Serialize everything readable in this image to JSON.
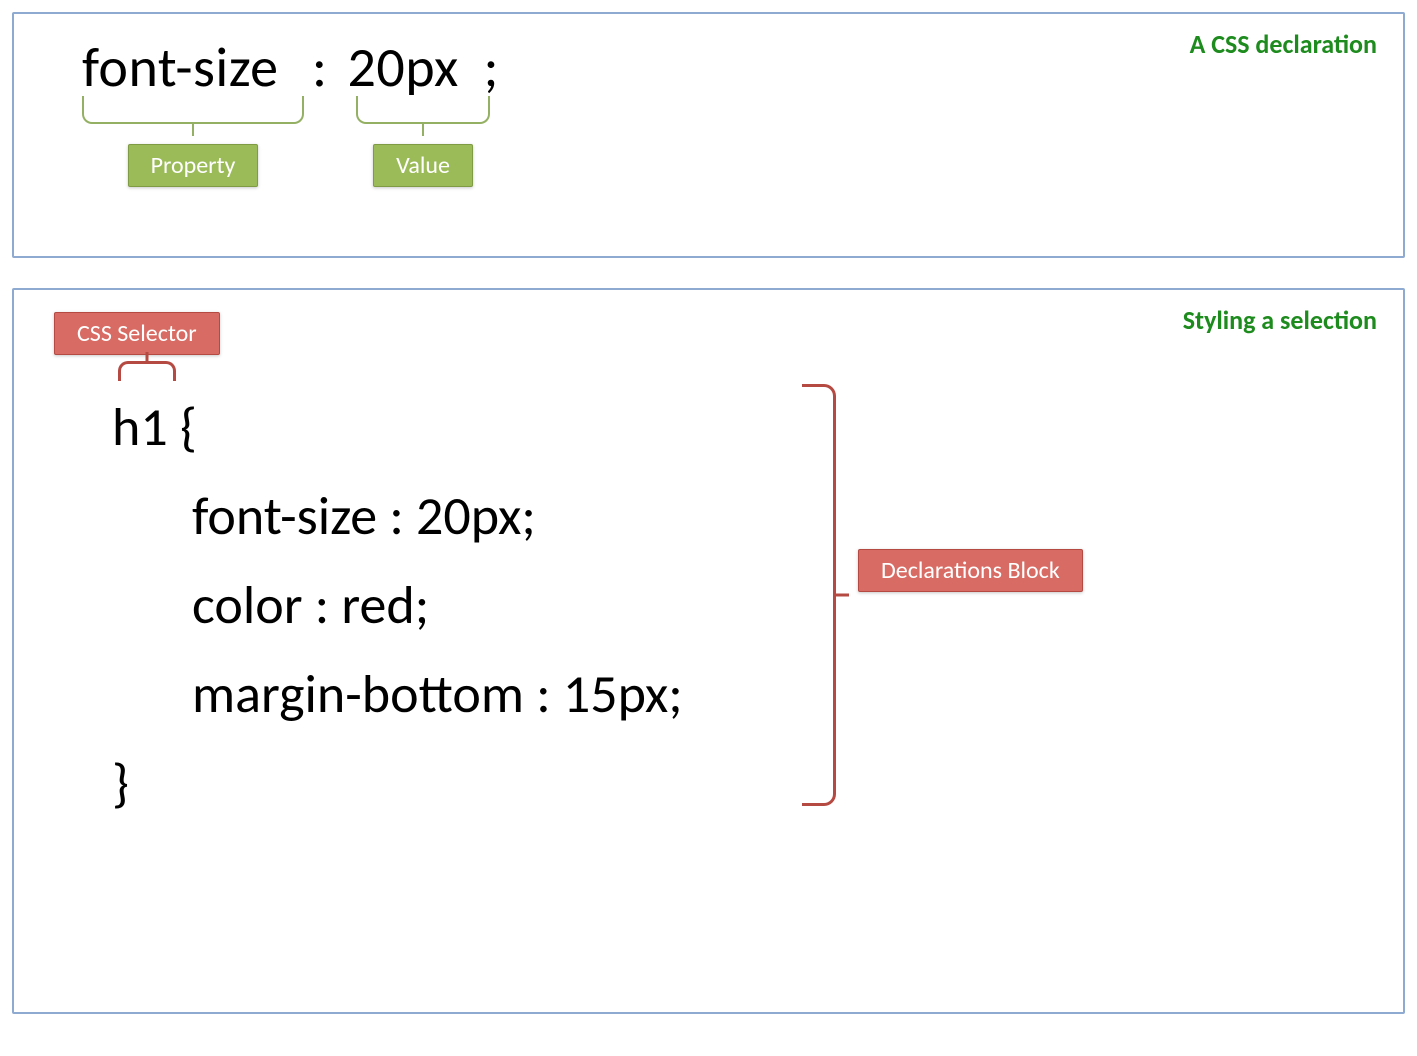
{
  "panel1": {
    "title": "A CSS declaration",
    "property": "font-size",
    "separator": ":",
    "value": "20px",
    "terminator": ";",
    "property_label": "Property",
    "value_label": "Value"
  },
  "panel2": {
    "title": "Styling a selection",
    "selector_label": "CSS Selector",
    "selector": "h1",
    "open_brace": " {",
    "declarations": [
      "font-size : 20px;",
      "color : red;",
      "margin-bottom : 15px;"
    ],
    "close_brace": "}",
    "block_label": "Declarations Block"
  }
}
